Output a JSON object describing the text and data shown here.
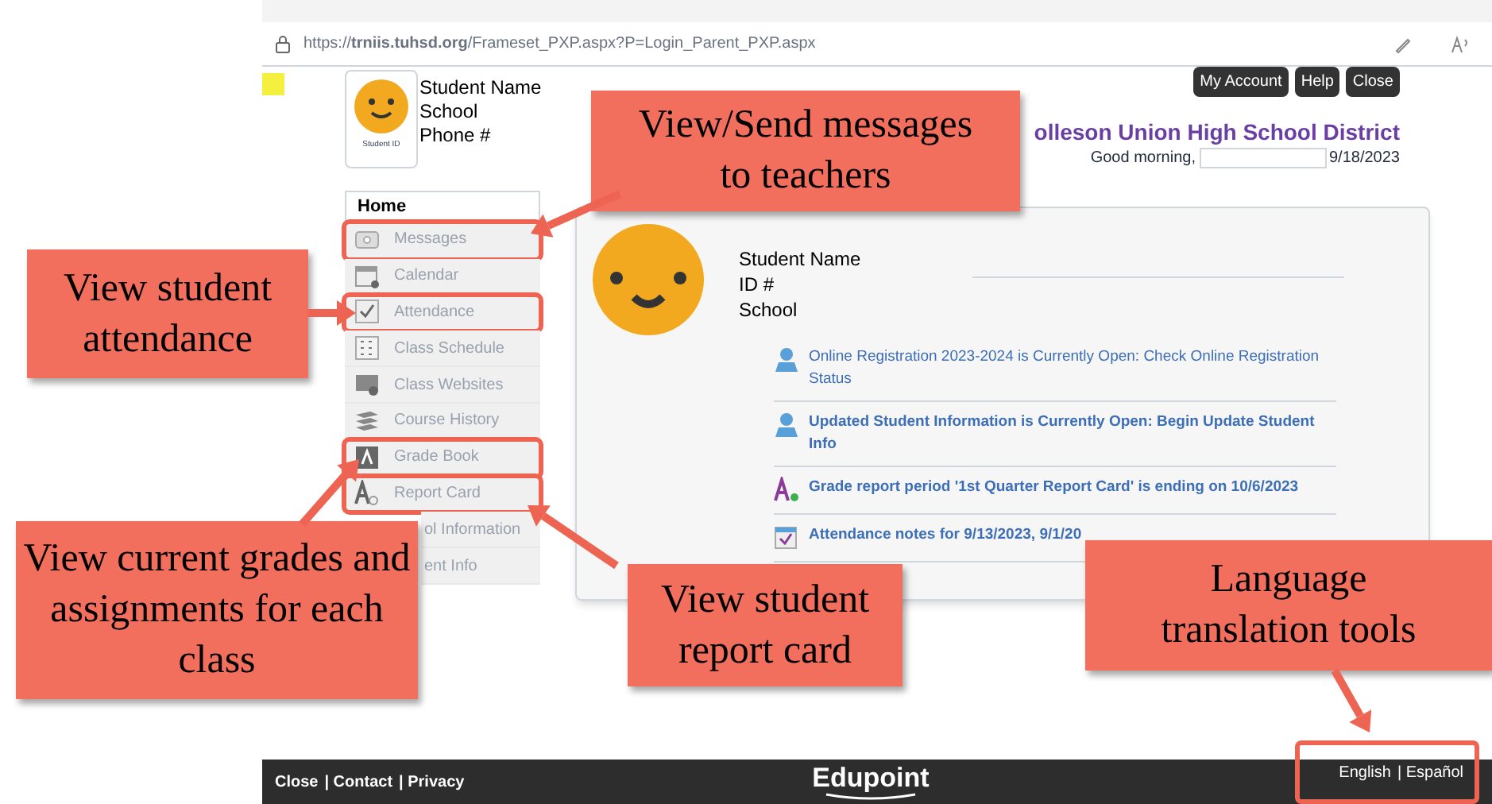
{
  "browser": {
    "url": "https://**trniis.tuhsd.org**/Frameset_PXP.aspx?P=Login_Parent_PXP.aspx"
  },
  "header": {
    "avatar_caption": "Student ID",
    "student_lines": [
      "Student Name",
      "School",
      "Phone #"
    ],
    "buttons": [
      "My Account",
      "Help",
      "Close"
    ],
    "district": "olleson Union High School District",
    "greeting": "Good morning,",
    "date": "9/18/2023"
  },
  "sidebar": {
    "heading": "Home",
    "items": [
      {
        "label": "Messages",
        "kind": "messages",
        "highlighted": true
      },
      {
        "label": "Calendar",
        "kind": "calendar",
        "highlighted": false
      },
      {
        "label": "Attendance",
        "kind": "attendance",
        "highlighted": true
      },
      {
        "label": "Class Schedule",
        "kind": "schedule",
        "highlighted": false
      },
      {
        "label": "Class Websites",
        "kind": "websites",
        "highlighted": false
      },
      {
        "label": "Course History",
        "kind": "history",
        "highlighted": false
      },
      {
        "label": "Grade Book",
        "kind": "gradebook",
        "highlighted": true
      },
      {
        "label": "Report Card",
        "kind": "reportcard",
        "highlighted": true
      },
      {
        "label": "ol Information",
        "kind": "covered",
        "highlighted": false
      },
      {
        "label": "ent Info",
        "kind": "covered",
        "highlighted": false
      }
    ]
  },
  "panel": {
    "student_lines": [
      "Student Name",
      "ID #",
      "School"
    ],
    "notifications": [
      {
        "text": "Online Registration 2023-2024 is Currently Open: Check Online Registration Status",
        "kind": "person",
        "bold": false
      },
      {
        "text": "Updated Student Information is Currently Open: Begin Update Student Info",
        "kind": "person",
        "bold": true
      },
      {
        "text": "Grade report period '1st Quarter Report Card' is ending on 10/6/2023",
        "kind": "grade",
        "bold": true
      },
      {
        "text": "Attendance notes for 9/13/2023, 9/1/20",
        "kind": "attendance",
        "bold": true
      }
    ]
  },
  "footer": {
    "links": [
      "Close",
      "| Contact",
      "| Privacy"
    ],
    "logo": "Edupoint",
    "languages": [
      "English",
      "| Español"
    ],
    "languages_highlighted": true
  },
  "callouts": [
    {
      "text": "View/Send messages to teachers"
    },
    {
      "text": "View student attendance"
    },
    {
      "text": "View current grades and assignments for each class"
    },
    {
      "text": "View student report card"
    },
    {
      "text": "Language translation tools"
    }
  ]
}
